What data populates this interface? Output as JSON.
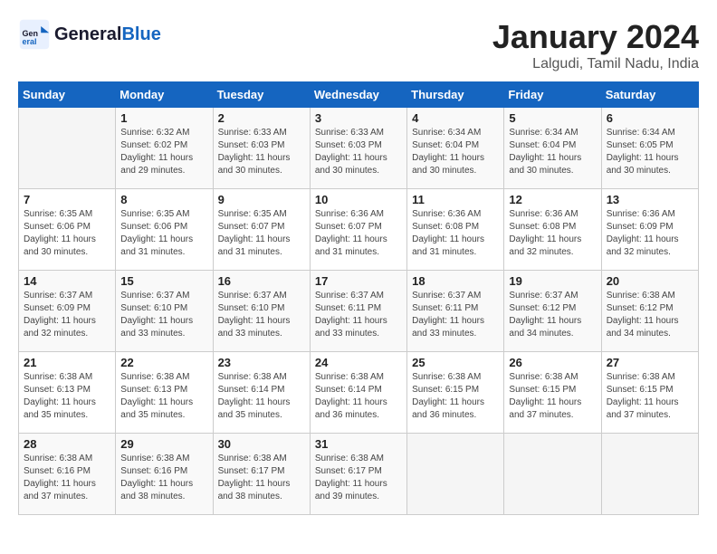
{
  "header": {
    "logo_general": "General",
    "logo_blue": "Blue",
    "title": "January 2024",
    "subtitle": "Lalgudi, Tamil Nadu, India"
  },
  "calendar": {
    "days_of_week": [
      "Sunday",
      "Monday",
      "Tuesday",
      "Wednesday",
      "Thursday",
      "Friday",
      "Saturday"
    ],
    "weeks": [
      [
        {
          "day": "",
          "info": ""
        },
        {
          "day": "1",
          "info": "Sunrise: 6:32 AM\nSunset: 6:02 PM\nDaylight: 11 hours\nand 29 minutes."
        },
        {
          "day": "2",
          "info": "Sunrise: 6:33 AM\nSunset: 6:03 PM\nDaylight: 11 hours\nand 30 minutes."
        },
        {
          "day": "3",
          "info": "Sunrise: 6:33 AM\nSunset: 6:03 PM\nDaylight: 11 hours\nand 30 minutes."
        },
        {
          "day": "4",
          "info": "Sunrise: 6:34 AM\nSunset: 6:04 PM\nDaylight: 11 hours\nand 30 minutes."
        },
        {
          "day": "5",
          "info": "Sunrise: 6:34 AM\nSunset: 6:04 PM\nDaylight: 11 hours\nand 30 minutes."
        },
        {
          "day": "6",
          "info": "Sunrise: 6:34 AM\nSunset: 6:05 PM\nDaylight: 11 hours\nand 30 minutes."
        }
      ],
      [
        {
          "day": "7",
          "info": "Sunrise: 6:35 AM\nSunset: 6:06 PM\nDaylight: 11 hours\nand 30 minutes."
        },
        {
          "day": "8",
          "info": "Sunrise: 6:35 AM\nSunset: 6:06 PM\nDaylight: 11 hours\nand 31 minutes."
        },
        {
          "day": "9",
          "info": "Sunrise: 6:35 AM\nSunset: 6:07 PM\nDaylight: 11 hours\nand 31 minutes."
        },
        {
          "day": "10",
          "info": "Sunrise: 6:36 AM\nSunset: 6:07 PM\nDaylight: 11 hours\nand 31 minutes."
        },
        {
          "day": "11",
          "info": "Sunrise: 6:36 AM\nSunset: 6:08 PM\nDaylight: 11 hours\nand 31 minutes."
        },
        {
          "day": "12",
          "info": "Sunrise: 6:36 AM\nSunset: 6:08 PM\nDaylight: 11 hours\nand 32 minutes."
        },
        {
          "day": "13",
          "info": "Sunrise: 6:36 AM\nSunset: 6:09 PM\nDaylight: 11 hours\nand 32 minutes."
        }
      ],
      [
        {
          "day": "14",
          "info": "Sunrise: 6:37 AM\nSunset: 6:09 PM\nDaylight: 11 hours\nand 32 minutes."
        },
        {
          "day": "15",
          "info": "Sunrise: 6:37 AM\nSunset: 6:10 PM\nDaylight: 11 hours\nand 33 minutes."
        },
        {
          "day": "16",
          "info": "Sunrise: 6:37 AM\nSunset: 6:10 PM\nDaylight: 11 hours\nand 33 minutes."
        },
        {
          "day": "17",
          "info": "Sunrise: 6:37 AM\nSunset: 6:11 PM\nDaylight: 11 hours\nand 33 minutes."
        },
        {
          "day": "18",
          "info": "Sunrise: 6:37 AM\nSunset: 6:11 PM\nDaylight: 11 hours\nand 33 minutes."
        },
        {
          "day": "19",
          "info": "Sunrise: 6:37 AM\nSunset: 6:12 PM\nDaylight: 11 hours\nand 34 minutes."
        },
        {
          "day": "20",
          "info": "Sunrise: 6:38 AM\nSunset: 6:12 PM\nDaylight: 11 hours\nand 34 minutes."
        }
      ],
      [
        {
          "day": "21",
          "info": "Sunrise: 6:38 AM\nSunset: 6:13 PM\nDaylight: 11 hours\nand 35 minutes."
        },
        {
          "day": "22",
          "info": "Sunrise: 6:38 AM\nSunset: 6:13 PM\nDaylight: 11 hours\nand 35 minutes."
        },
        {
          "day": "23",
          "info": "Sunrise: 6:38 AM\nSunset: 6:14 PM\nDaylight: 11 hours\nand 35 minutes."
        },
        {
          "day": "24",
          "info": "Sunrise: 6:38 AM\nSunset: 6:14 PM\nDaylight: 11 hours\nand 36 minutes."
        },
        {
          "day": "25",
          "info": "Sunrise: 6:38 AM\nSunset: 6:15 PM\nDaylight: 11 hours\nand 36 minutes."
        },
        {
          "day": "26",
          "info": "Sunrise: 6:38 AM\nSunset: 6:15 PM\nDaylight: 11 hours\nand 37 minutes."
        },
        {
          "day": "27",
          "info": "Sunrise: 6:38 AM\nSunset: 6:15 PM\nDaylight: 11 hours\nand 37 minutes."
        }
      ],
      [
        {
          "day": "28",
          "info": "Sunrise: 6:38 AM\nSunset: 6:16 PM\nDaylight: 11 hours\nand 37 minutes."
        },
        {
          "day": "29",
          "info": "Sunrise: 6:38 AM\nSunset: 6:16 PM\nDaylight: 11 hours\nand 38 minutes."
        },
        {
          "day": "30",
          "info": "Sunrise: 6:38 AM\nSunset: 6:17 PM\nDaylight: 11 hours\nand 38 minutes."
        },
        {
          "day": "31",
          "info": "Sunrise: 6:38 AM\nSunset: 6:17 PM\nDaylight: 11 hours\nand 39 minutes."
        },
        {
          "day": "",
          "info": ""
        },
        {
          "day": "",
          "info": ""
        },
        {
          "day": "",
          "info": ""
        }
      ]
    ]
  }
}
